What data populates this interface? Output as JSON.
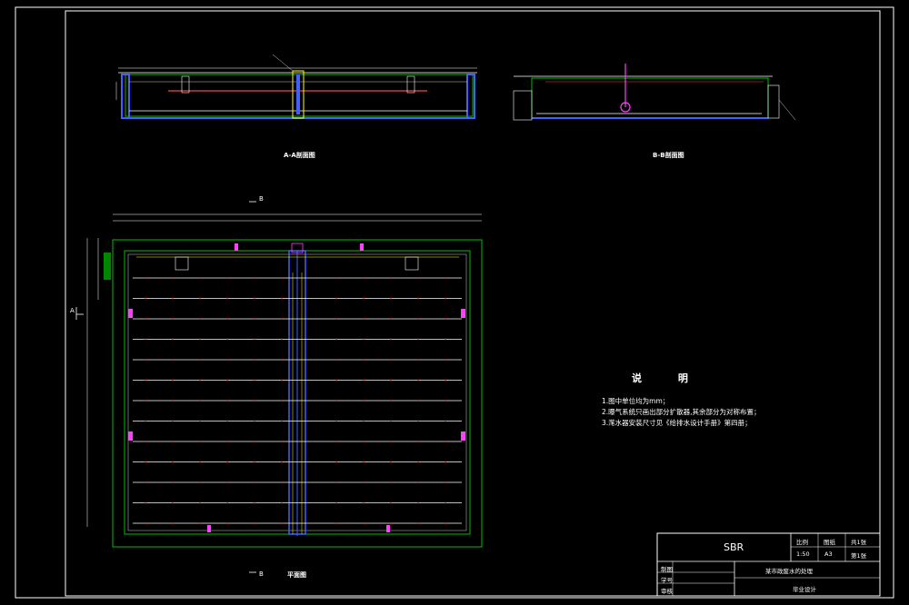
{
  "sections": {
    "aa_title": "A-A剖面图",
    "bb_title": "B-B剖面图",
    "plan_title": "平面图"
  },
  "markers": {
    "a_left": "A",
    "b_top": "B",
    "b_bottom": "B"
  },
  "notes": {
    "title": "说 明",
    "items": [
      "1.图中单位均为mm；",
      "2.曝气系统只画出部分扩散器,其余部分为对称布置；",
      "3.滗水器安装尺寸见《给排水设计手册》第四册；"
    ]
  },
  "title_block": {
    "project": "SBR",
    "ratio_label": "比例",
    "ratio_value": "1:50",
    "sheet_label": "图纸",
    "sheet_value": "A3",
    "total_label": "共1张",
    "total_value": "第1张",
    "design_title": "某市政废水的处理",
    "drawn_label": "制图",
    "student_label": "学号",
    "check_label": "审核",
    "footer": "毕业设计"
  },
  "colors": {
    "background": "#000000",
    "border": "#ffffff",
    "wall": "#00c000",
    "pipe_white": "#ffffff",
    "pipe_red": "#ff4040",
    "blue": "#4060ff",
    "magenta": "#ff40ff",
    "yellow": "#ffff00",
    "cyan": "#00ffff"
  }
}
